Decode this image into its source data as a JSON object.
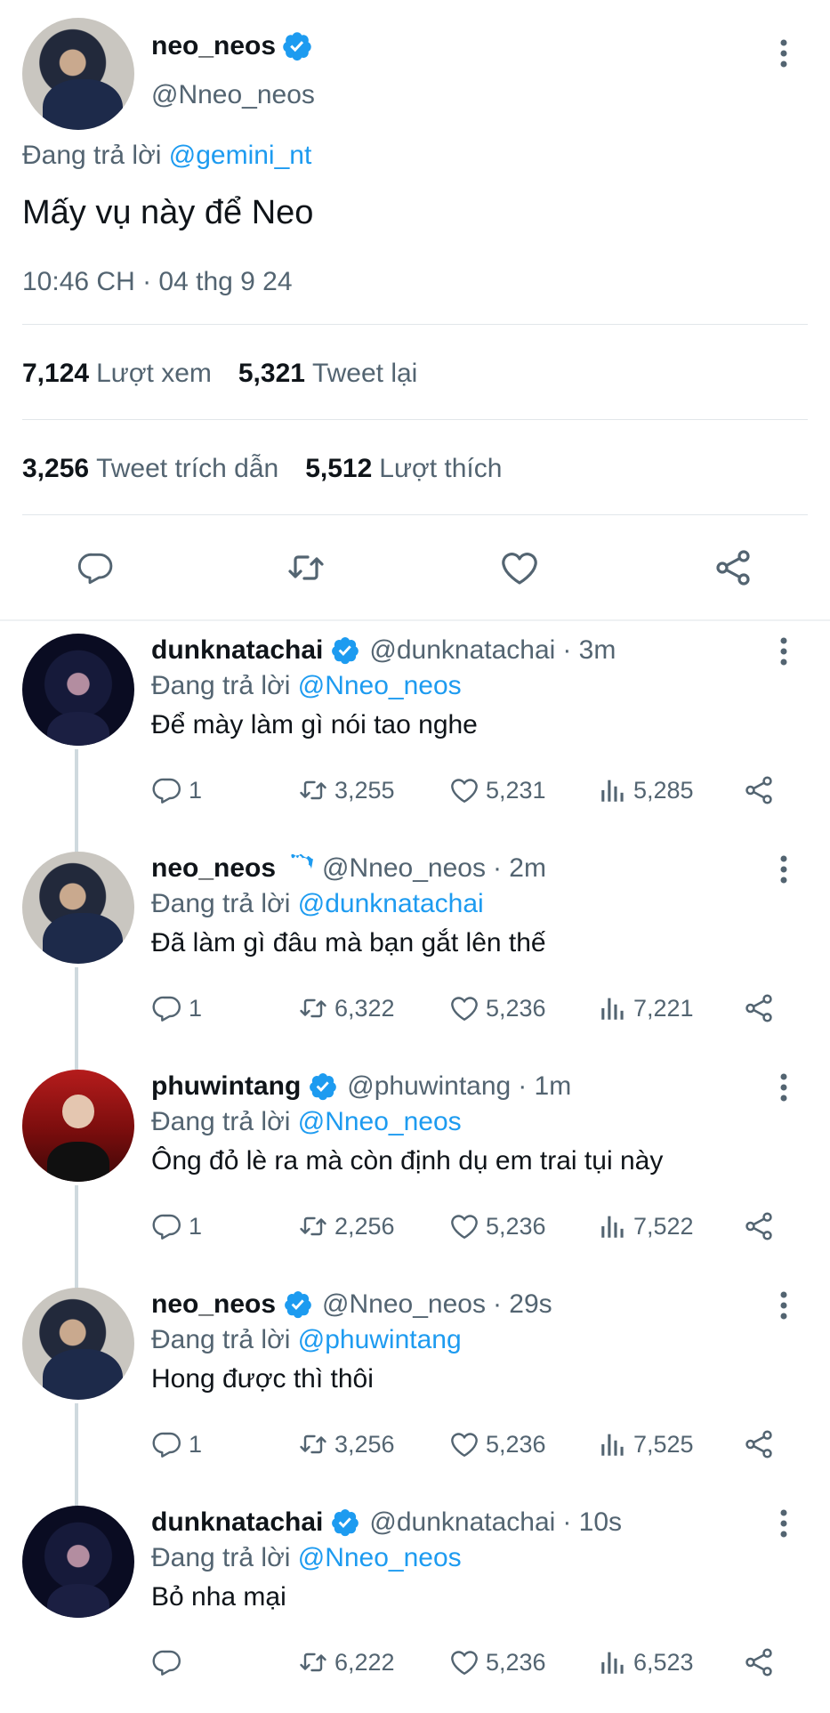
{
  "main_tweet": {
    "name": "neo_neos",
    "handle": "@Nneo_neos",
    "replying_prefix": "Đang trả lời",
    "replying_to": "@gemini_nt",
    "text": "Mấy vụ này để Neo",
    "timestamp": "10:46 CH · 04 thg 9 24",
    "stats": {
      "views_count": "7,124",
      "views_label": "Lượt xem",
      "retweets_count": "5,321",
      "retweets_label": "Tweet lại",
      "quotes_count": "3,256",
      "quotes_label": "Tweet trích dẫn",
      "likes_count": "5,512",
      "likes_label": "Lượt thích"
    }
  },
  "colors": {
    "accent": "#1d9bf0",
    "muted": "#536471",
    "text": "#0f1419",
    "thread_line": "#cfd9de"
  },
  "icons": [
    "more-vertical-icon",
    "verified-badge-icon",
    "reply-icon",
    "retweet-icon",
    "like-icon",
    "share-icon",
    "views-icon"
  ],
  "replies": [
    {
      "name": "dunknatachai",
      "handle": "@dunknatachai",
      "time": "· 3m",
      "replying_prefix": "Đang trả lời",
      "replying_to": "@Nneo_neos",
      "text": "Để mày làm gì nói tao nghe",
      "reply_count": "1",
      "retweet_count": "3,255",
      "like_count": "5,231",
      "view_count": "5,285"
    },
    {
      "name": "neo_neos",
      "handle": "@Nneo_neos",
      "time": "· 2m",
      "replying_prefix": "Đang trả lời",
      "replying_to": "@dunknatachai",
      "text": "Đã làm gì đâu mà bạn gắt lên thế",
      "reply_count": "1",
      "retweet_count": "6,322",
      "like_count": "5,236",
      "view_count": "7,221"
    },
    {
      "name": "phuwintang",
      "handle": "@phuwintang",
      "time": "· 1m",
      "replying_prefix": "Đang trả lời",
      "replying_to": "@Nneo_neos",
      "text": "Ông đỏ lè ra mà còn định dụ em trai tụi này",
      "reply_count": "1",
      "retweet_count": "2,256",
      "like_count": "5,236",
      "view_count": "7,522"
    },
    {
      "name": "neo_neos",
      "handle": "@Nneo_neos",
      "time": "· 29s",
      "replying_prefix": "Đang trả lời",
      "replying_to": "@phuwintang",
      "text": "Hong được thì thôi",
      "reply_count": "1",
      "retweet_count": "3,256",
      "like_count": "5,236",
      "view_count": "7,525"
    },
    {
      "name": "dunknatachai",
      "handle": "@dunknatachai",
      "time": "· 10s",
      "replying_prefix": "Đang trả lời",
      "replying_to": "@Nneo_neos",
      "text": "Bỏ nha mại",
      "reply_count": "",
      "retweet_count": "6,222",
      "like_count": "5,236",
      "view_count": "6,523"
    }
  ]
}
